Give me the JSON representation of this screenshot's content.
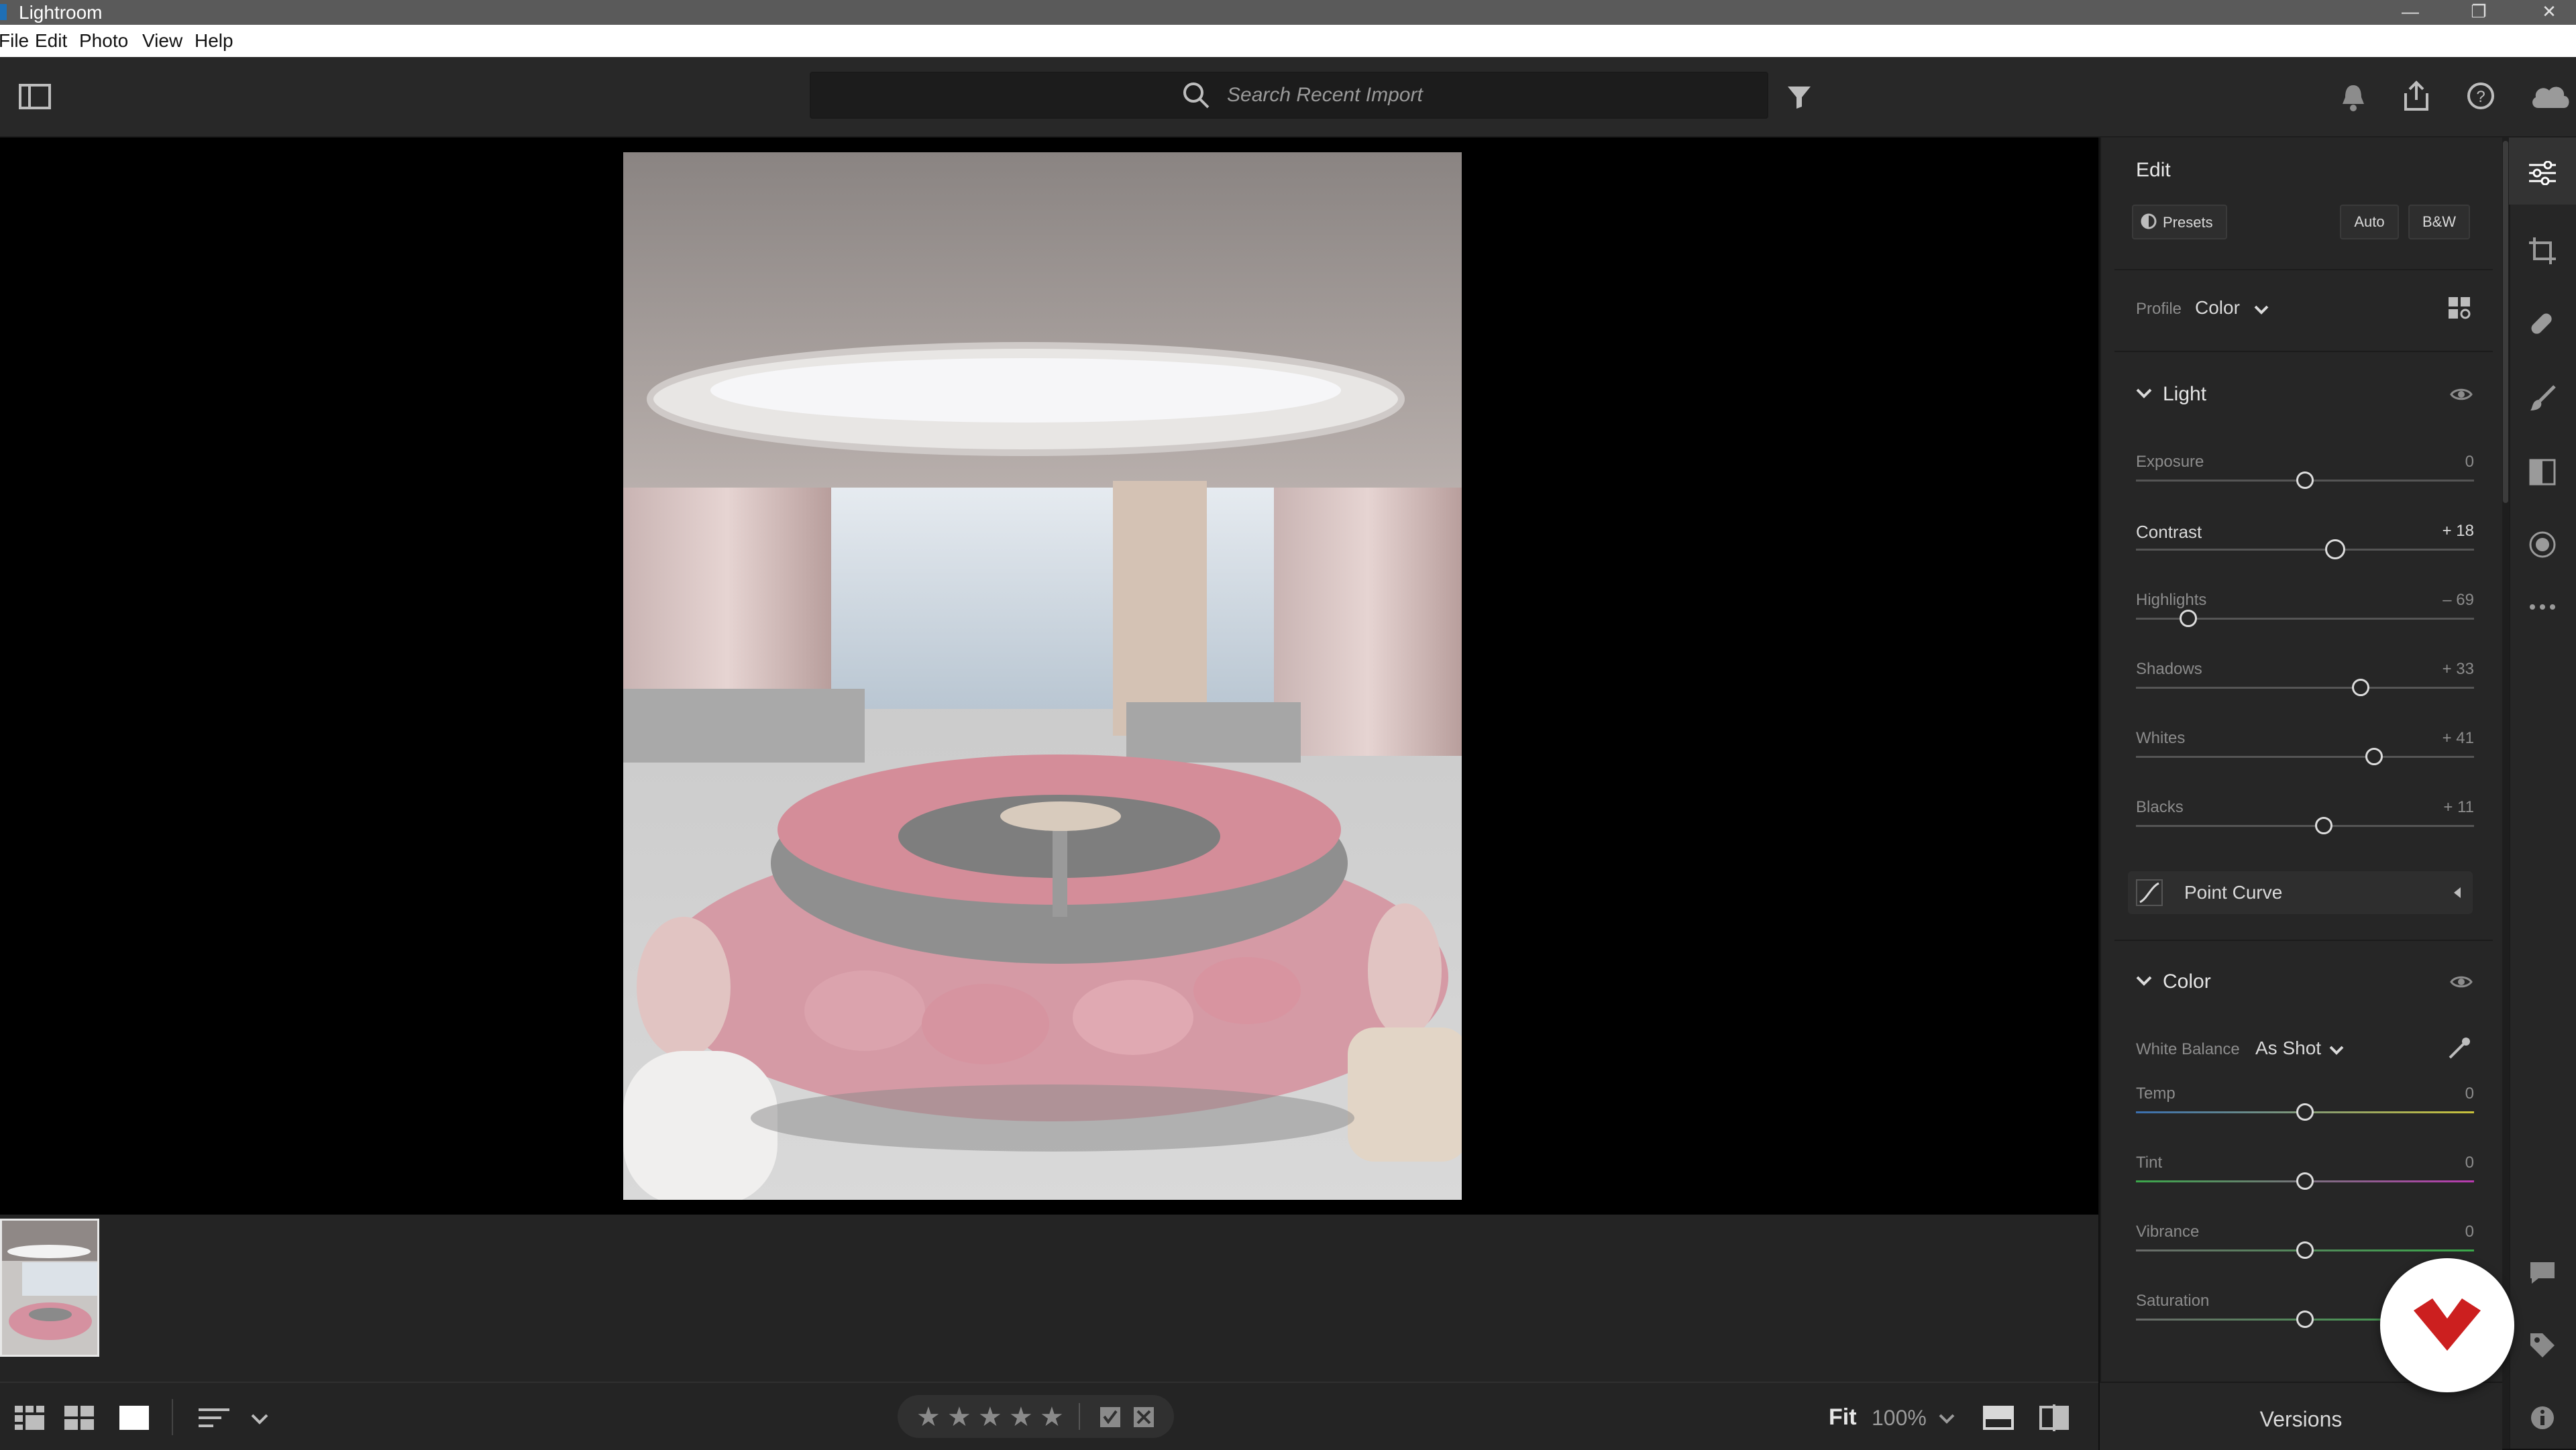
{
  "window": {
    "title": "Lightroom"
  },
  "menu": [
    "File",
    "Edit",
    "Photo",
    "View",
    "Help"
  ],
  "search": {
    "placeholder": "Search Recent Import"
  },
  "panel": {
    "title": "Edit",
    "presets_label": "Presets",
    "auto_label": "Auto",
    "bw_label": "B&W",
    "profile_label": "Profile",
    "profile_value": "Color",
    "light": {
      "title": "Light",
      "sliders": [
        {
          "label": "Exposure",
          "value": "0",
          "level": 0
        },
        {
          "label": "Contrast",
          "value": "+ 18",
          "level": 18
        },
        {
          "label": "Highlights",
          "value": "– 69",
          "level": -69
        },
        {
          "label": "Shadows",
          "value": "+ 33",
          "level": 33
        },
        {
          "label": "Whites",
          "value": "+ 41",
          "level": 41
        },
        {
          "label": "Blacks",
          "value": "+ 11",
          "level": 11
        }
      ]
    },
    "point_curve_label": "Point Curve",
    "color": {
      "title": "Color",
      "wb_label": "White Balance",
      "wb_value": "As Shot",
      "sliders": [
        {
          "label": "Temp",
          "value": "0",
          "level": 0
        },
        {
          "label": "Tint",
          "value": "0",
          "level": 0
        },
        {
          "label": "Vibrance",
          "value": "0",
          "level": 0
        },
        {
          "label": "Saturation",
          "value": "",
          "level": 0
        }
      ]
    }
  },
  "bottom": {
    "fit_label": "Fit",
    "zoom_label": "100%",
    "versions_label": "Versions",
    "rating": 0
  },
  "colors": {
    "accent_badge": "#cc1f1f",
    "panel_bg": "#262626",
    "view_bg": "#000000"
  }
}
